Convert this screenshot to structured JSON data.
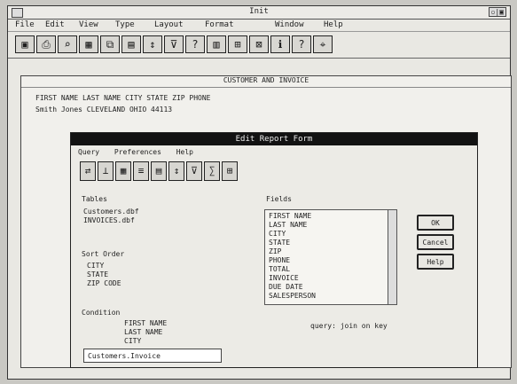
{
  "window": {
    "title": "Init",
    "control": "▫|▣"
  },
  "menu": [
    "File",
    "Edit",
    "View",
    "Type",
    "Layout",
    "Format",
    "Window",
    "Help"
  ],
  "toolbar": {
    "icons": [
      "disk-icon",
      "printer-icon",
      "search-icon",
      "table-icon",
      "copy-icon",
      "paste-icon",
      "sort-icon",
      "filter-icon",
      "query-icon",
      "chart-icon",
      "open-icon",
      "close-icon",
      "info-icon",
      "help-icon",
      "pin-icon"
    ]
  },
  "inner": {
    "title": "CUSTOMER AND INVOICE",
    "line1": "FIRST NAME  LAST NAME  CITY  STATE  ZIP  PHONE",
    "line2": "Smith    Jones    CLEVELAND  OHIO  44113"
  },
  "dialog": {
    "title": "Edit Report Form",
    "menu": [
      "Query",
      "Preferences",
      "Help"
    ],
    "tables_label": "Tables",
    "tables_items": [
      "Customers.dbf",
      "INVOICES.dbf"
    ],
    "fields_label": "Fields",
    "fields_items": [
      "FIRST NAME",
      "LAST NAME",
      "CITY",
      "STATE",
      "ZIP",
      "PHONE",
      "TOTAL",
      "INVOICE",
      "DUE DATE",
      "SALESPERSON"
    ],
    "selected_label": "Sort Order",
    "selected_items": [
      "CITY",
      "STATE",
      "ZIP CODE"
    ],
    "condition_label": "Condition",
    "condition_rows": [
      "FIRST NAME",
      "LAST NAME",
      "CITY"
    ],
    "buttons": [
      "OK",
      "Cancel",
      "Help"
    ],
    "query_note": "query: join on key",
    "bottom_field": "Customers.Invoice"
  }
}
